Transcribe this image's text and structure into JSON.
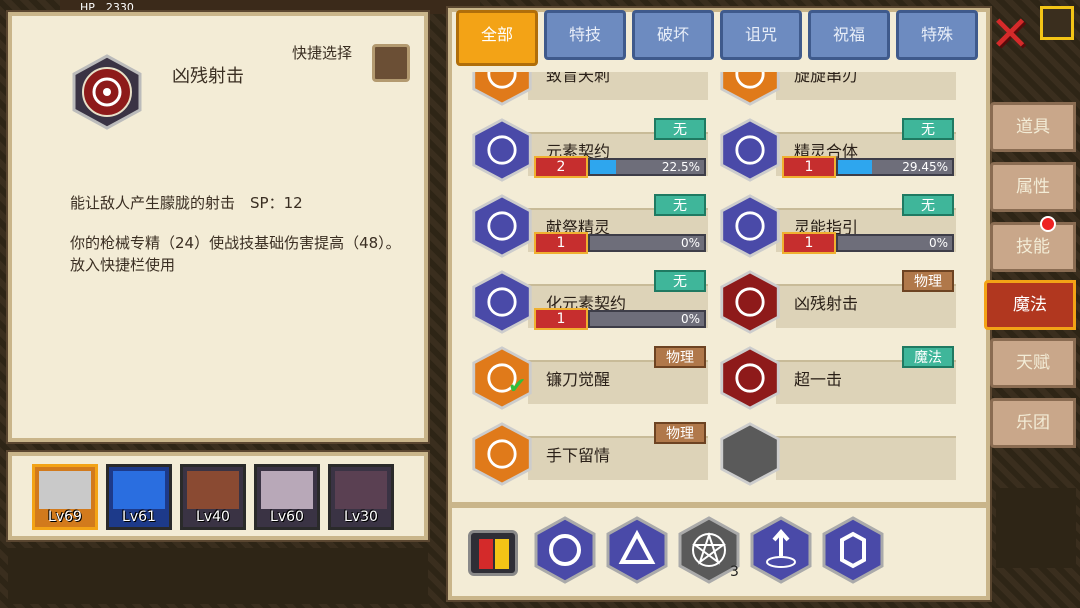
{
  "topbar": {
    "hp_label": "HP",
    "hp_value": "2330"
  },
  "detail": {
    "skill_name": "凶残射击",
    "quick_select_label": "快捷选择",
    "description": "能让敌人产生朦胧的射击　SP：12",
    "effect": "你的枪械专精（24）使战技基础伤害提高（48）。　　　　放入快捷栏使用"
  },
  "party": [
    {
      "level": "Lv69",
      "selected": true
    },
    {
      "level": "Lv61",
      "selected": false
    },
    {
      "level": "Lv40",
      "selected": false
    },
    {
      "level": "Lv60",
      "selected": false
    },
    {
      "level": "Lv30",
      "selected": false
    }
  ],
  "tabs": [
    "全部",
    "特技",
    "破坏",
    "诅咒",
    "祝福",
    "特殊"
  ],
  "active_tab": "全部",
  "skills_left": [
    {
      "name": "致盲天刺",
      "tag": "",
      "tag_type": "",
      "icon": "slash-icon"
    },
    {
      "name": "元素契约",
      "tag": "无",
      "tag_type": "none",
      "level": "2",
      "progress": 22.5,
      "pct": "22.5%",
      "icon": "pentagram-icon"
    },
    {
      "name": "献祭精灵",
      "tag": "无",
      "tag_type": "none",
      "level": "1",
      "progress": 0,
      "pct": "0%",
      "icon": "triangle-spirit-icon"
    },
    {
      "name": "化元素契约",
      "tag": "无",
      "tag_type": "none",
      "level": "1",
      "progress": 0,
      "pct": "0%",
      "icon": "arrow-up-circle-icon"
    },
    {
      "name": "镰刀觉醒",
      "tag": "物理",
      "tag_type": "phys",
      "icon": "scythe-icon"
    },
    {
      "name": "手下留情",
      "tag": "物理",
      "tag_type": "phys",
      "icon": "palm-icon"
    }
  ],
  "skills_right": [
    {
      "name": "旋旋串刃",
      "tag": "",
      "tag_type": "",
      "icon": "blade-icon"
    },
    {
      "name": "精灵合体",
      "tag": "无",
      "tag_type": "none",
      "level": "1",
      "progress": 29.45,
      "pct": "29.45%",
      "icon": "spiral-icon"
    },
    {
      "name": "灵能指引",
      "tag": "无",
      "tag_type": "none",
      "level": "1",
      "progress": 0,
      "pct": "0%",
      "icon": "hexagon-link-icon"
    },
    {
      "name": "凶残射击",
      "tag": "物理",
      "tag_type": "phys",
      "icon": "target-icon"
    },
    {
      "name": "超一击",
      "tag": "魔法",
      "tag_type": "magic",
      "icon": "crown-icon"
    },
    {
      "name": "",
      "tag": "",
      "tag_type": "",
      "icon": "empty-slot-icon"
    }
  ],
  "quickbar_count": "3",
  "side_tabs": [
    "道具",
    "属性",
    "技能",
    "魔法",
    "天赋",
    "乐团"
  ],
  "side_active": "魔法",
  "colors": {
    "accent": "#f3a316",
    "tab_blue": "#6d8bc0",
    "panel": "#f3ecd6",
    "level_red": "#c62e2e",
    "progress_blue": "#2ea6ee"
  }
}
